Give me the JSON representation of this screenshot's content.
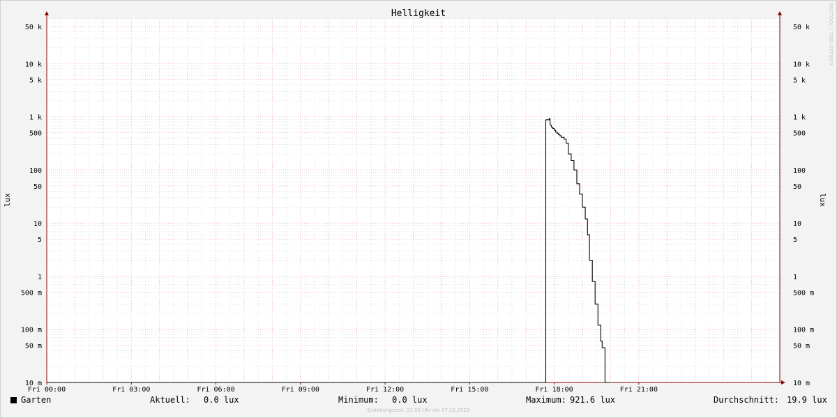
{
  "chart_data": {
    "type": "line",
    "title": "Helligkeit",
    "ylabel": "lux",
    "ylabel_right": "lux",
    "y_scale": "log",
    "ylim": [
      0.01,
      70000
    ],
    "xlim": [
      0,
      26
    ],
    "x_unit": "hours since Fri 00:00",
    "grid": true,
    "x_ticks": [
      {
        "value": 0,
        "label": "Fri 00:00"
      },
      {
        "value": 3,
        "label": "Fri 03:00"
      },
      {
        "value": 6,
        "label": "Fri 06:00"
      },
      {
        "value": 9,
        "label": "Fri 09:00"
      },
      {
        "value": 12,
        "label": "Fri 12:00"
      },
      {
        "value": 15,
        "label": "Fri 15:00"
      },
      {
        "value": 18,
        "label": "Fri 18:00"
      },
      {
        "value": 21,
        "label": "Fri 21:00"
      }
    ],
    "y_ticks": [
      {
        "value": 50000,
        "label": "50 k"
      },
      {
        "value": 10000,
        "label": "10 k"
      },
      {
        "value": 5000,
        "label": "5 k"
      },
      {
        "value": 1000,
        "label": "1 k"
      },
      {
        "value": 500,
        "label": "500"
      },
      {
        "value": 100,
        "label": "100"
      },
      {
        "value": 50,
        "label": "50"
      },
      {
        "value": 10,
        "label": "10"
      },
      {
        "value": 5,
        "label": "5"
      },
      {
        "value": 1,
        "label": "1"
      },
      {
        "value": 0.5,
        "label": "500 m"
      },
      {
        "value": 0.1,
        "label": "100 m"
      },
      {
        "value": 0.05,
        "label": "50 m"
      },
      {
        "value": 0.01,
        "label": "10 m"
      }
    ],
    "series": [
      {
        "name": "Garten",
        "color": "#000000",
        "x": [
          0,
          17.7,
          17.7,
          17.82,
          17.85,
          17.9,
          17.95,
          18.0,
          18.05,
          18.1,
          18.15,
          18.2,
          18.25,
          18.35,
          18.42,
          18.5,
          18.6,
          18.7,
          18.8,
          18.9,
          19.0,
          19.1,
          19.18,
          19.25,
          19.35,
          19.45,
          19.55,
          19.65,
          19.7,
          19.8,
          19.9,
          20.0
        ],
        "y": [
          0.01,
          0.01,
          880,
          921.6,
          700,
          640,
          600,
          560,
          520,
          490,
          460,
          440,
          410,
          380,
          320,
          200,
          150,
          100,
          55,
          35,
          20,
          12,
          6,
          2,
          0.8,
          0.3,
          0.12,
          0.06,
          0.045,
          0.01,
          0.01,
          0.01
        ]
      }
    ],
    "right_axis_marker": true
  },
  "legend": {
    "series_name": "Garten",
    "current_label": "Aktuell:",
    "current_value": "0.0 lux",
    "min_label": "Minimum:",
    "min_value": "0.0 lux",
    "max_label": "Maximum:",
    "max_value": "921.6 lux",
    "avg_label": "Durchschnitt:",
    "avg_value": "19.9 lux"
  },
  "footer": "Erstellungszeit: 23:55 Uhr am 07.10.2022",
  "watermark": "RRDTOOL / TOBI OETIKER",
  "colors": {
    "background": "#f3f3f3",
    "plot_background": "#ffffff",
    "major_grid": "#e8a0a0",
    "minor_grid": "#d0d0d0",
    "axis": "#8b0000",
    "line": "#000000"
  }
}
